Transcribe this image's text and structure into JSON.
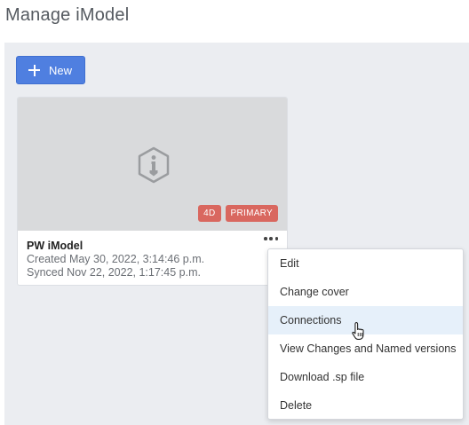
{
  "page": {
    "title": "Manage iModel"
  },
  "toolbar": {
    "new_label": "New",
    "new_icon": "plus-icon",
    "accent_color": "#4f7fe0"
  },
  "card": {
    "name": "PW iModel",
    "created": "Created May 30, 2022, 3:14:46 p.m.",
    "synced": "Synced Nov 22, 2022, 1:17:45 p.m.",
    "thumbnail_icon": "imodel-icon",
    "badges": [
      "4D",
      "PRIMARY"
    ],
    "badge_color": "#d9675f",
    "more_icon": "more-horizontal-icon"
  },
  "menu": {
    "items": [
      {
        "label": "Edit"
      },
      {
        "label": "Change cover"
      },
      {
        "label": "Connections",
        "hovered": true
      },
      {
        "label": "View Changes and Named versions"
      },
      {
        "label": "Download .sp file"
      },
      {
        "label": "Delete"
      }
    ]
  }
}
